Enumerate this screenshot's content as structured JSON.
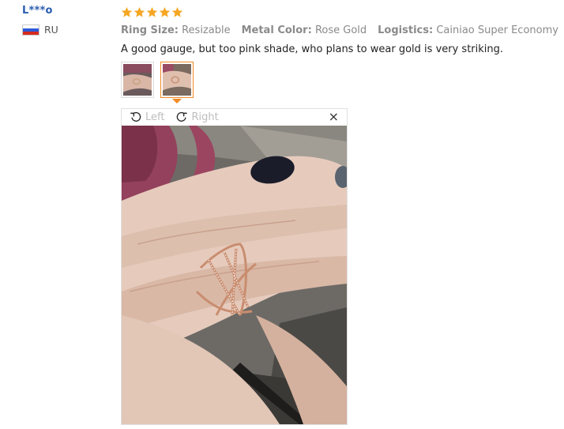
{
  "user": {
    "name": "L***o",
    "country": "RU"
  },
  "review": {
    "rating": 5,
    "attributes": [
      {
        "label": "Ring Size:",
        "value": "Resizable"
      },
      {
        "label": "Metal Color:",
        "value": "Rose Gold"
      },
      {
        "label": "Logistics:",
        "value": "Cainiao Super Economy"
      }
    ],
    "comment": "A good gauge, but too pink shade, who plans to wear gold is very striking.",
    "thumbnails": [
      {
        "icon": "photo-thumbnail",
        "active": false
      },
      {
        "icon": "photo-thumbnail",
        "active": true
      }
    ]
  },
  "viewer": {
    "rotate_left_label": "Left",
    "rotate_right_label": "Right",
    "close_glyph": "×"
  },
  "colors": {
    "username": "#2a5db0",
    "star": "#f5a623",
    "active_border": "#f08a24"
  }
}
